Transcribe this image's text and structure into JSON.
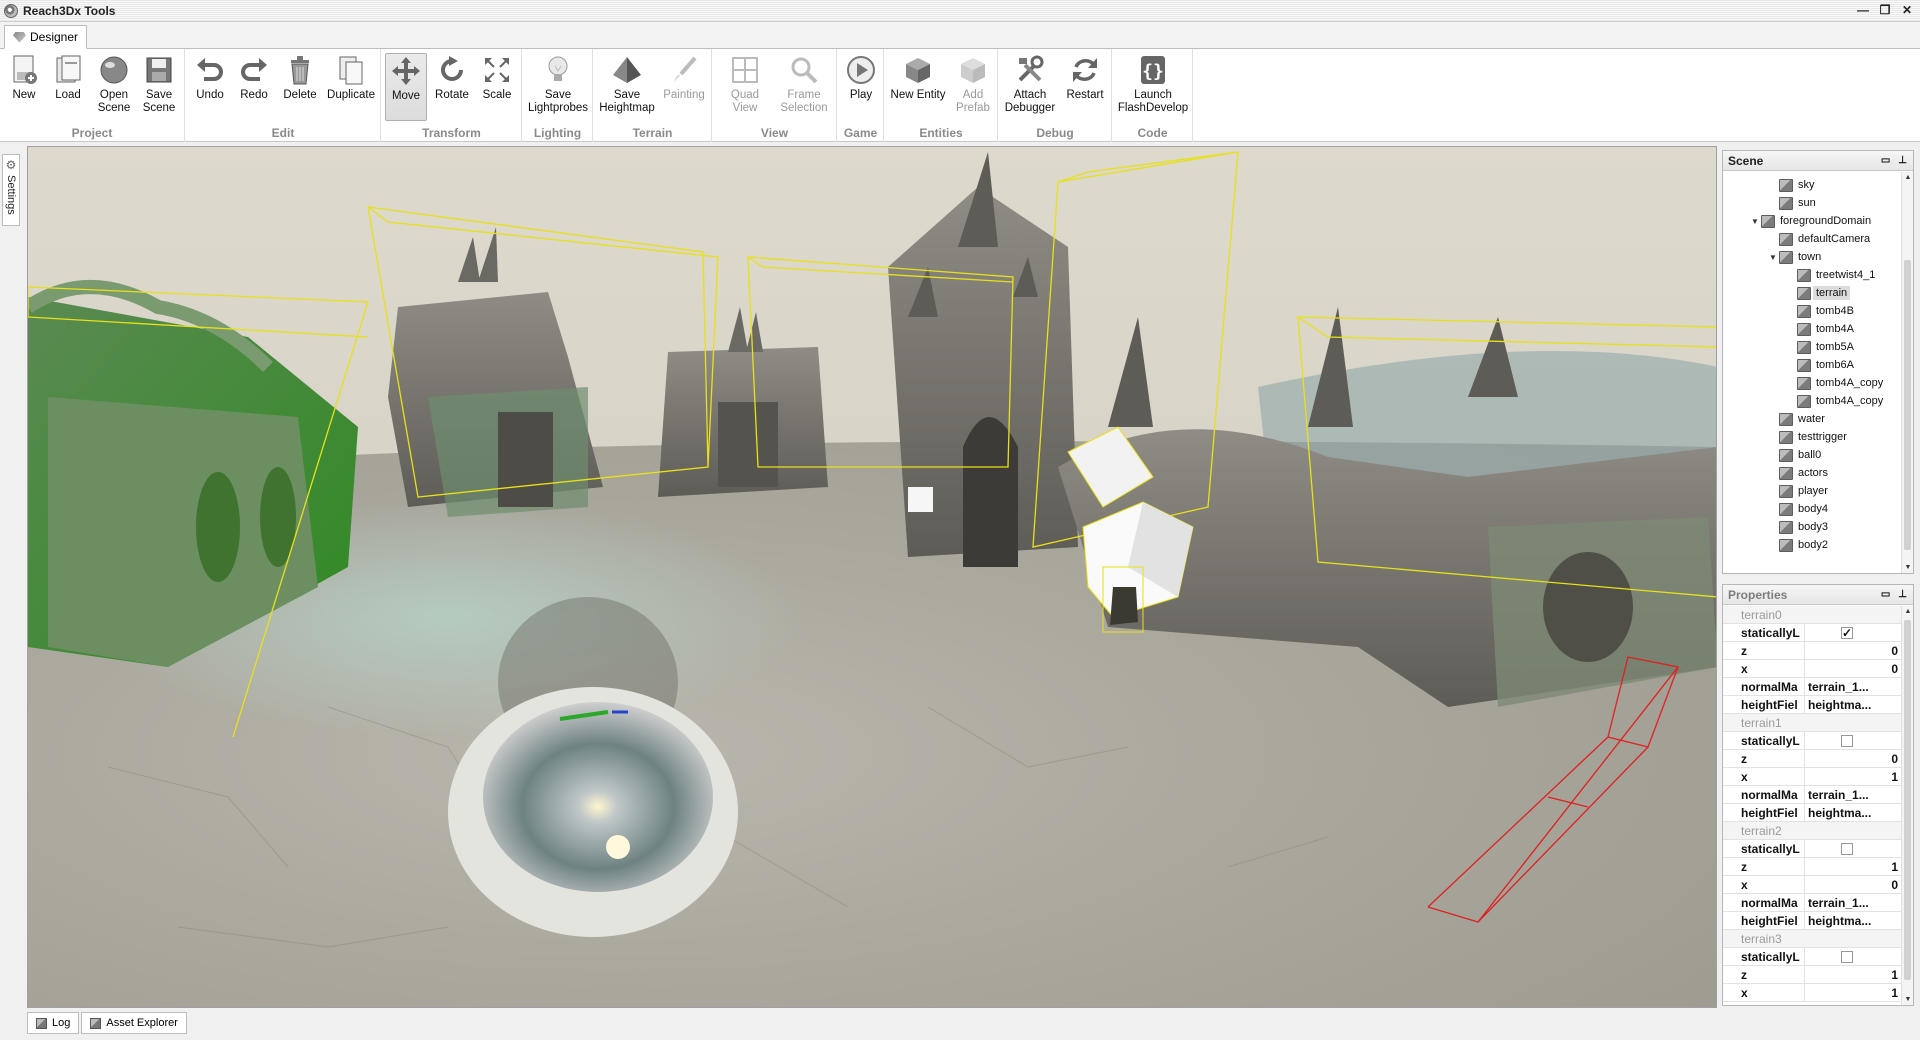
{
  "window": {
    "title": "Reach3Dx Tools",
    "controls": [
      "—",
      "❐",
      "✕"
    ]
  },
  "ribbon_tab": "Designer",
  "toolbar": {
    "groups": [
      {
        "label": "Project",
        "buttons": [
          {
            "label": "New",
            "icon": "new-project-icon"
          },
          {
            "label": "Load",
            "icon": "load-icon"
          },
          {
            "label": "Open\nScene",
            "icon": "open-scene-icon"
          },
          {
            "label": "Save\nScene",
            "icon": "save-icon"
          }
        ]
      },
      {
        "label": "Edit",
        "buttons": [
          {
            "label": "Undo",
            "icon": "undo-icon"
          },
          {
            "label": "Redo",
            "icon": "redo-icon"
          },
          {
            "label": "Delete",
            "icon": "trash-icon"
          },
          {
            "label": "Duplicate",
            "icon": "duplicate-icon"
          }
        ]
      },
      {
        "label": "Transform",
        "buttons": [
          {
            "label": "Move",
            "icon": "move-icon",
            "active": true
          },
          {
            "label": "Rotate",
            "icon": "rotate-icon"
          },
          {
            "label": "Scale",
            "icon": "scale-icon"
          }
        ]
      },
      {
        "label": "Lighting",
        "buttons": [
          {
            "label": "Save\nLightprobes",
            "icon": "lightbulb-icon"
          }
        ]
      },
      {
        "label": "Terrain",
        "buttons": [
          {
            "label": "Save\nHeightmap",
            "icon": "pyramid-icon"
          },
          {
            "label": "Painting",
            "icon": "brush-icon",
            "disabled": true
          }
        ]
      },
      {
        "label": "View",
        "buttons": [
          {
            "label": "Quad View",
            "icon": "quad-view-icon",
            "disabled": true
          },
          {
            "label": "Frame\nSelection",
            "icon": "magnifier-icon",
            "disabled": true
          }
        ]
      },
      {
        "label": "Game",
        "buttons": [
          {
            "label": "Play",
            "icon": "play-icon"
          }
        ]
      },
      {
        "label": "Entities",
        "buttons": [
          {
            "label": "New Entity",
            "icon": "cube-icon"
          },
          {
            "label": "Add\nPrefab",
            "icon": "prefab-icon",
            "disabled": true
          }
        ]
      },
      {
        "label": "Debug",
        "buttons": [
          {
            "label": "Attach\nDebugger",
            "icon": "tools-icon"
          },
          {
            "label": "Restart",
            "icon": "restart-icon"
          }
        ]
      },
      {
        "label": "Code",
        "buttons": [
          {
            "label": "Launch\nFlashDevelop",
            "icon": "flashdevelop-icon"
          }
        ]
      }
    ]
  },
  "left_strip": {
    "settings_label": "Settings"
  },
  "scene_panel": {
    "title": "Scene",
    "items": [
      {
        "label": "sky",
        "depth": 2
      },
      {
        "label": "sun",
        "depth": 2
      },
      {
        "label": "foregroundDomain",
        "depth": 1,
        "expanded": true
      },
      {
        "label": "defaultCamera",
        "depth": 2
      },
      {
        "label": "town",
        "depth": 2,
        "expanded": true
      },
      {
        "label": "treetwist4_1",
        "depth": 3
      },
      {
        "label": "terrain",
        "depth": 3,
        "selected": true
      },
      {
        "label": "tomb4B",
        "depth": 3
      },
      {
        "label": "tomb4A",
        "depth": 3
      },
      {
        "label": "tomb5A",
        "depth": 3
      },
      {
        "label": "tomb6A",
        "depth": 3
      },
      {
        "label": "tomb4A_copy",
        "depth": 3
      },
      {
        "label": "tomb4A_copy",
        "depth": 3
      },
      {
        "label": "water",
        "depth": 2
      },
      {
        "label": "testtrigger",
        "depth": 2
      },
      {
        "label": "ball0",
        "depth": 2
      },
      {
        "label": "actors",
        "depth": 2
      },
      {
        "label": "player",
        "depth": 2
      },
      {
        "label": "body4",
        "depth": 2
      },
      {
        "label": "body3",
        "depth": 2
      },
      {
        "label": "body2",
        "depth": 2
      }
    ]
  },
  "properties_panel": {
    "title": "Properties",
    "rows": [
      {
        "type": "category",
        "label": "terrain0"
      },
      {
        "type": "check",
        "key": "staticallyL",
        "checked": true
      },
      {
        "type": "value",
        "key": "z",
        "value": "0"
      },
      {
        "type": "value",
        "key": "x",
        "value": "0"
      },
      {
        "type": "text",
        "key": "normalMa",
        "value": "terrain_1..."
      },
      {
        "type": "text",
        "key": "heightFiel",
        "value": "heightma..."
      },
      {
        "type": "category",
        "label": "terrain1"
      },
      {
        "type": "check",
        "key": "staticallyL",
        "checked": false
      },
      {
        "type": "value",
        "key": "z",
        "value": "0"
      },
      {
        "type": "value",
        "key": "x",
        "value": "1"
      },
      {
        "type": "text",
        "key": "normalMa",
        "value": "terrain_1..."
      },
      {
        "type": "text",
        "key": "heightFiel",
        "value": "heightma..."
      },
      {
        "type": "category",
        "label": "terrain2"
      },
      {
        "type": "check",
        "key": "staticallyL",
        "checked": false
      },
      {
        "type": "value",
        "key": "z",
        "value": "1"
      },
      {
        "type": "value",
        "key": "x",
        "value": "0"
      },
      {
        "type": "text",
        "key": "normalMa",
        "value": "terrain_1..."
      },
      {
        "type": "text",
        "key": "heightFiel",
        "value": "heightma..."
      },
      {
        "type": "category",
        "label": "terrain3"
      },
      {
        "type": "check",
        "key": "staticallyL",
        "checked": false
      },
      {
        "type": "value",
        "key": "z",
        "value": "1"
      },
      {
        "type": "value",
        "key": "x",
        "value": "1"
      }
    ]
  },
  "bottom_tabs": [
    {
      "label": "Log"
    },
    {
      "label": "Asset Explorer"
    }
  ],
  "colors": {
    "selection_box": "#e8e01a",
    "trigger_box": "#e02020",
    "accent": "#000000"
  }
}
